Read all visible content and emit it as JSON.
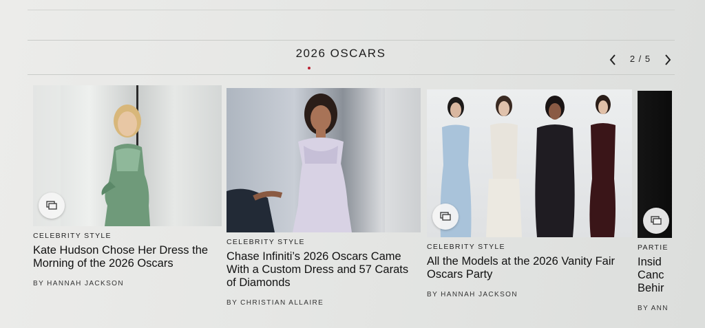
{
  "carousel": {
    "title": "2026 OSCARS",
    "page_counter": "2 / 5",
    "prev_icon": "chevron-left-icon",
    "next_icon": "chevron-right-icon"
  },
  "cards": [
    {
      "category": "CELEBRITY STYLE",
      "headline": "Kate Hudson Chose Her Dress the Morning of the 2026 Oscars",
      "byline": "BY HANNAH JACKSON",
      "icon": "gallery-icon"
    },
    {
      "category": "CELEBRITY STYLE",
      "headline": "Chase Infiniti’s 2026 Oscars Came With a Custom Dress and 57 Carats of Diamonds",
      "byline": "BY CHRISTIAN ALLAIRE",
      "icon": "gallery-icon"
    },
    {
      "category": "CELEBRITY STYLE",
      "headline": "All the Models at the 2026 Vanity Fair Oscars Party",
      "byline": "BY HANNAH JACKSON",
      "icon": "gallery-icon"
    },
    {
      "category": "PARTIE",
      "headline_lines": [
        "Insid",
        "Canc",
        "Behir"
      ],
      "byline": "BY ANN",
      "icon": "gallery-icon"
    }
  ],
  "colors": {
    "background": "#e4e5e3",
    "accent_dot": "#bb2233"
  }
}
